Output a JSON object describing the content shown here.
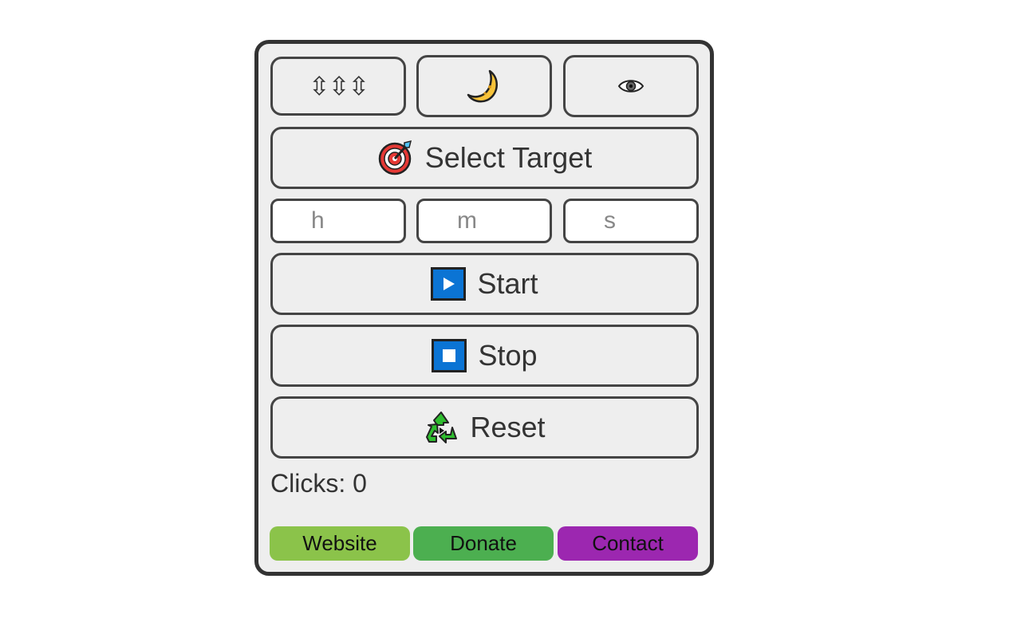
{
  "toolbar": {
    "reposition_icon": "⇳⇳⇳",
    "dark_mode_icon": "moon-icon",
    "visibility_icon": "eye-icon"
  },
  "select_target": {
    "label": "Select Target",
    "icon": "target-icon"
  },
  "timer": {
    "hours_placeholder": "h",
    "minutes_placeholder": "m",
    "seconds_placeholder": "s"
  },
  "start": {
    "label": "Start",
    "icon": "play-icon"
  },
  "stop": {
    "label": "Stop",
    "icon": "stop-icon"
  },
  "reset": {
    "label": "Reset",
    "icon": "recycle-icon"
  },
  "clicks": {
    "text": "Clicks: 0"
  },
  "links": {
    "website": {
      "label": "Website",
      "color": "#8bc34a"
    },
    "donate": {
      "label": "Donate",
      "color": "#4caf50"
    },
    "contact": {
      "label": "Contact",
      "color": "#9c27b0"
    }
  },
  "colors": {
    "panel_bg": "#eeeeee",
    "border": "#333333",
    "accent_blue": "#0b74d4"
  }
}
